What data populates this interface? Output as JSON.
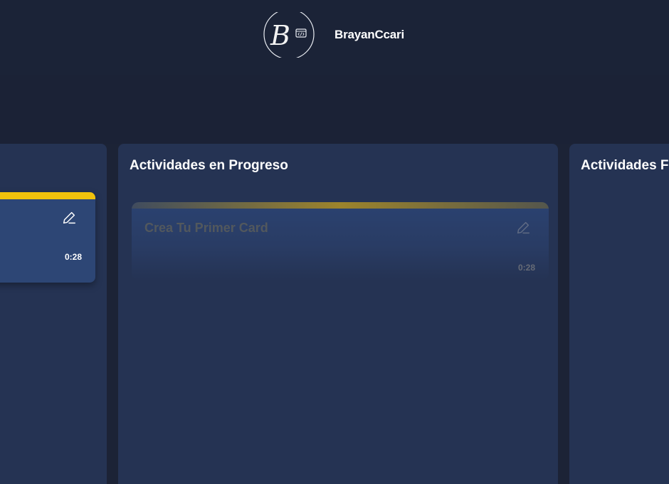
{
  "header": {
    "brand_name": "BrayanCcari",
    "logo_letter": "B",
    "logo_icon": "code-window-icon"
  },
  "columns": [
    {
      "title": "",
      "cards": [
        {
          "title": "",
          "time": "0:28",
          "accent": "#f1c20c",
          "icon": "edit-icon"
        }
      ]
    },
    {
      "title": "Actividades en Progreso",
      "cards": [
        {
          "title": "Crea Tu Primer Card",
          "time": "0:28",
          "accent": "#a4892a",
          "icon": "edit-icon",
          "state": "dragging"
        }
      ]
    },
    {
      "title": "Actividades F",
      "cards": []
    }
  ],
  "colors": {
    "background": "#1c2336",
    "column": "#253353",
    "card": "#2d4675",
    "accent_yellow": "#f1c20c"
  }
}
